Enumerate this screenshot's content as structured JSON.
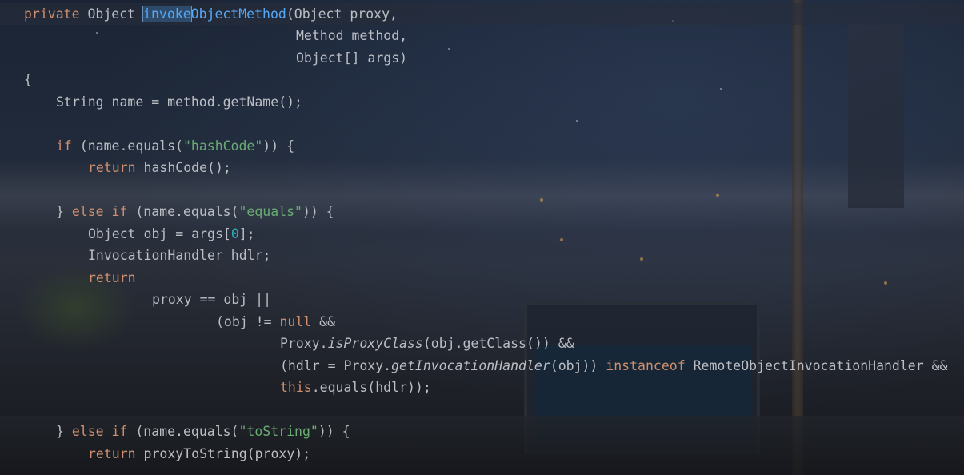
{
  "code": {
    "l1_private": "private",
    "l1_object": " Object ",
    "l1_invoke": "invoke",
    "l1_rest_name": "ObjectMethod",
    "l1_params": "(Object proxy,",
    "l2": "Method method,",
    "l3": "Object[] args)",
    "l4": "{",
    "l5": "String name = method.getName();",
    "l6_if": "if",
    "l6_a": " (name.equals(",
    "l6_str": "\"hashCode\"",
    "l6_b": ")) {",
    "l7_ret": "return",
    "l7_rest": " hashCode();",
    "l8_brace": "} ",
    "l8_else": "else if",
    "l8_a": " (name.equals(",
    "l8_str": "\"equals\"",
    "l8_b": ")) {",
    "l9_a": "Object obj = args[",
    "l9_num": "0",
    "l9_b": "];",
    "l10": "InvocationHandler hdlr;",
    "l11": "return",
    "l12": "proxy == obj ||",
    "l13_a": "(obj != ",
    "l13_null": "null",
    "l13_b": " &&",
    "l14_a": "Proxy.",
    "l14_m": "isProxyClass",
    "l14_b": "(obj.getClass()) &&",
    "l15_a": "(hdlr = Proxy.",
    "l15_m": "getInvocationHandler",
    "l15_b": "(obj)) ",
    "l15_kw": "instanceof",
    "l15_c": " RemoteObjectInvocationHandler &&",
    "l16_this": "this",
    "l16_rest": ".equals(hdlr));",
    "l17_brace": "} ",
    "l17_else": "else if",
    "l17_a": " (name.equals(",
    "l17_str": "\"toString\"",
    "l17_b": ")) {",
    "l18_ret": "return",
    "l18_rest": " proxyToString(proxy);"
  },
  "colors": {
    "keyword": "#cf8e6d",
    "string": "#6aab73",
    "number": "#2aacb8",
    "method_decl": "#56a8f5",
    "text": "#bcbec4"
  }
}
